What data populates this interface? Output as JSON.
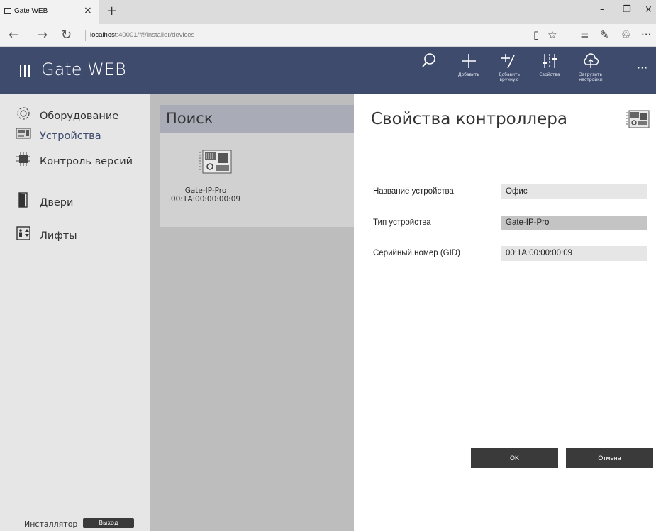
{
  "browser": {
    "tab_title": "Gate WEB",
    "tab_close": "×",
    "new_tab": "+",
    "url_host": "localhost",
    "url_rest": ":40001/#!/installer/devices",
    "win_minimize": "–",
    "win_restore": "❐",
    "win_close": "×",
    "nav_back": "←",
    "nav_forward": "→",
    "nav_refresh": "↻",
    "toolbar_reading": "▯",
    "toolbar_favorite": "☆",
    "toolbar_hub": "≡",
    "toolbar_note": "✎",
    "toolbar_share": "♲",
    "toolbar_more": "···"
  },
  "header": {
    "title": "Gate WEB",
    "actions": [
      {
        "label": "",
        "icon": "search-icon"
      },
      {
        "label": "Добавить",
        "icon": "plus-icon"
      },
      {
        "label": "Добавить вручную",
        "icon": "add-manual-icon"
      },
      {
        "label": "Свойства",
        "icon": "sliders-icon"
      },
      {
        "label": "Загрузить настройки",
        "icon": "cloud-upload-icon"
      }
    ],
    "more": "···"
  },
  "sidebar": {
    "items": [
      {
        "label": "Оборудование",
        "icon": "gear-icon"
      },
      {
        "label": "Устройства",
        "icon": "board-icon"
      },
      {
        "label": "Контроль версий",
        "icon": "chip-icon"
      },
      {
        "label": "Двери",
        "icon": "door-icon"
      },
      {
        "label": "Лифты",
        "icon": "elevator-icon"
      }
    ],
    "installer": "Инсталлятор",
    "logout": "Выход"
  },
  "search": {
    "title": "Поиск",
    "device": {
      "name": "Gate-IP-Pro",
      "gid": "00:1A:00:00:00:09"
    }
  },
  "properties": {
    "title": "Свойства контроллера",
    "fields": [
      {
        "label": "Название устройства",
        "value": "Офис"
      },
      {
        "label": "Тип устройства",
        "value": "Gate-IP-Pro"
      },
      {
        "label": "Серийный номер (GID)",
        "value": "00:1A:00:00:00:09"
      }
    ],
    "ok": "OK",
    "cancel": "Отмена"
  },
  "colors": {
    "header_bg": "#3f4b6d",
    "sidebar_bg": "#e6e6e6",
    "search_bg": "#bdbdbd",
    "button_bg": "#3a3a3a"
  }
}
